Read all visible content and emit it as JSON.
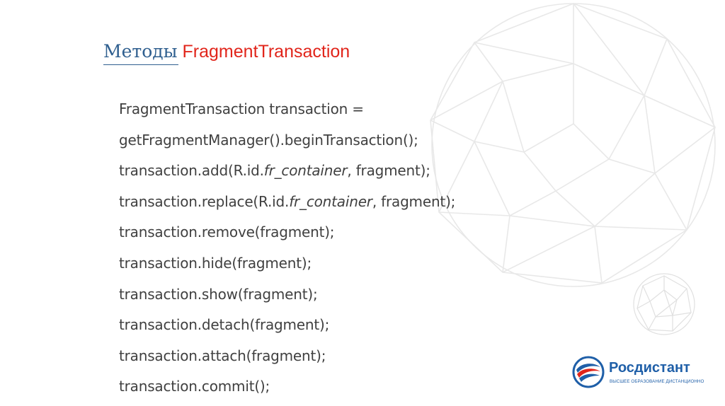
{
  "slide": {
    "title_prefix": "Методы",
    "title_suffix": "FragmentTransaction",
    "code_lines": [
      {
        "before": "FragmentTransaction transaction =",
        "italic": "",
        "after": ""
      },
      {
        "before": "getFragmentManager().beginTransaction();",
        "italic": "",
        "after": ""
      },
      {
        "before": "transaction.add(R.id.",
        "italic": "fr_container",
        "after": ", fragment);"
      },
      {
        "before": "transaction.replace(R.id.",
        "italic": "fr_container",
        "after": ", fragment);"
      },
      {
        "before": "transaction.remove(fragment);",
        "italic": "",
        "after": ""
      },
      {
        "before": "transaction.hide(fragment);",
        "italic": "",
        "after": ""
      },
      {
        "before": "transaction.show(fragment);",
        "italic": "",
        "after": ""
      },
      {
        "before": "transaction.detach(fragment);",
        "italic": "",
        "after": ""
      },
      {
        "before": "transaction.attach(fragment);",
        "italic": "",
        "after": ""
      },
      {
        "before": "transaction.commit();",
        "italic": "",
        "after": ""
      }
    ]
  },
  "logo": {
    "name": "Росдистант",
    "tagline": "ВЫСШЕЕ ОБРАЗОВАНИЕ ДИСТАНЦИОННО"
  },
  "colors": {
    "title_prefix": "#2f5f8f",
    "title_suffix": "#e1251b",
    "body_text": "#404040",
    "logo_blue": "#1f5fa8",
    "logo_red": "#e1251b",
    "background_pattern": "#e6e6e6"
  }
}
